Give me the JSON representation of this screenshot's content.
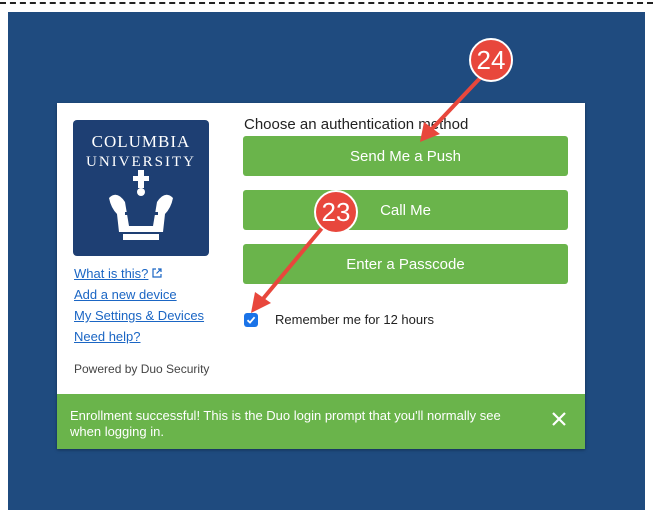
{
  "logo": {
    "line1": "Columbia",
    "line2": "University"
  },
  "links": [
    {
      "label": "What is this?",
      "icon": "external-link-icon"
    },
    {
      "label": "Add a new device"
    },
    {
      "label": "My Settings & Devices"
    },
    {
      "label": "Need help?"
    }
  ],
  "powered_by": "Powered by Duo Security",
  "prompt": {
    "title": "Choose an authentication method",
    "buttons": [
      "Send Me a Push",
      "Call Me",
      "Enter a Passcode"
    ],
    "remember_label": "Remember me for 12 hours",
    "remember_checked": true
  },
  "banner": {
    "message": "Enrollment successful! This is the Duo login prompt that you'll normally see when logging in.",
    "close_icon": "close-icon"
  },
  "annotations": [
    {
      "number": "24",
      "points_to": "Send Me a Push"
    },
    {
      "number": "23",
      "points_to": "Remember me checkbox"
    }
  ],
  "colors": {
    "background": "#1f4b7f",
    "button_green": "#6ab44b",
    "logo_blue": "#1e3f73",
    "link_blue": "#1b66c4",
    "callout_red": "#e8473c",
    "checkbox_blue": "#1a73e8"
  }
}
